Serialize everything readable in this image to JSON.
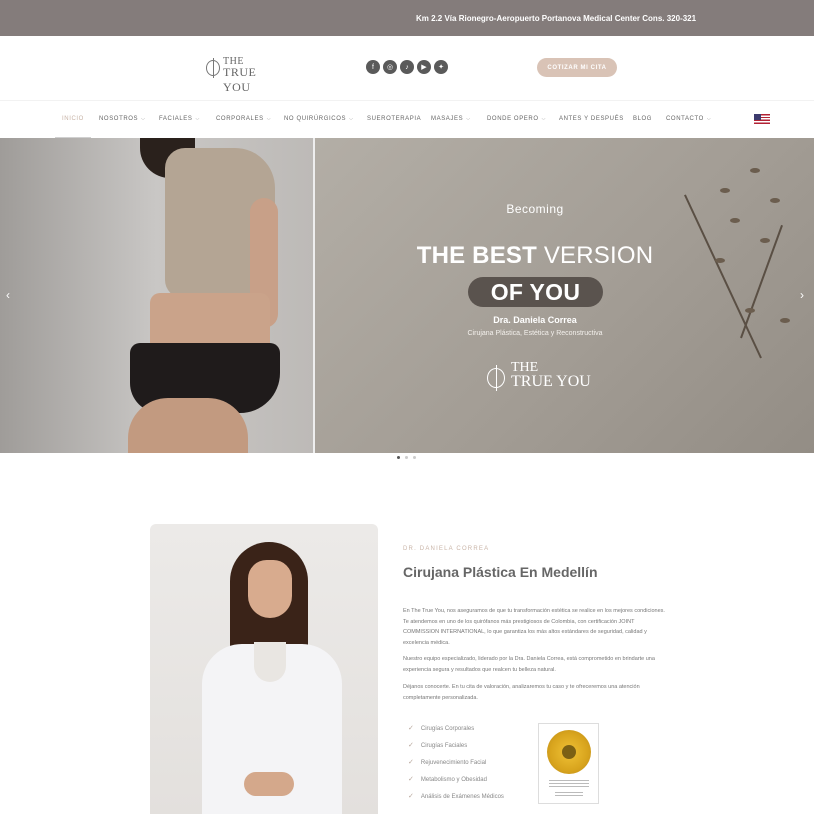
{
  "topbar": {
    "address": "Km 2.2 Vía Rionegro-Aeropuerto Portanova Medical Center Cons. 320-321"
  },
  "header": {
    "logo": {
      "line1": "THE",
      "line2": "TRUE YOU"
    },
    "socials": [
      {
        "icon": "facebook-icon",
        "glyph": "f"
      },
      {
        "icon": "instagram-icon",
        "glyph": "◎"
      },
      {
        "icon": "tiktok-icon",
        "glyph": "♪"
      },
      {
        "icon": "youtube-icon",
        "glyph": "▶"
      },
      {
        "icon": "twitter-icon",
        "glyph": "✦"
      }
    ],
    "cta_label": "COTIZAR MI CITA"
  },
  "nav": {
    "items": [
      {
        "label": "INICIO",
        "active": true,
        "dropdown": false
      },
      {
        "label": "NOSOTROS",
        "dropdown": true
      },
      {
        "label": "FACIALES",
        "dropdown": true
      },
      {
        "label": "CORPORALES",
        "dropdown": true
      },
      {
        "label": "NO QUIRÚRGICOS",
        "dropdown": true
      },
      {
        "label": "SUEROTERAPIA",
        "dropdown": false
      },
      {
        "label": "MASAJES",
        "dropdown": true
      },
      {
        "label": "DONDE OPERO",
        "dropdown": true
      },
      {
        "label": "ANTES Y DESPUÉS",
        "dropdown": false
      },
      {
        "label": "BLOG",
        "dropdown": false
      },
      {
        "label": "CONTACTO",
        "dropdown": true
      }
    ],
    "language_flag": "us-flag-icon"
  },
  "hero": {
    "becoming": "Becoming",
    "line1_bold": "THE BEST",
    "line1_rest": " VERSION",
    "pill": "OF YOU",
    "doctor": "Dra. Daniela Correa",
    "subtitle": "Cirujana Plástica, Estética y Reconstructiva",
    "logo": {
      "line1": "THE",
      "line2": "TRUE YOU"
    },
    "slides_total": 3,
    "slide_active": 1,
    "prev_glyph": "‹",
    "next_glyph": "›"
  },
  "about": {
    "kicker": "DR. DANIELA CORREA",
    "title": "Cirujana Plástica En Medellín",
    "p1": "En The True You, nos aseguramos de que tu transformación estética se realice en los mejores condiciones. Te atendemos en uno de los quirófanos más prestigiosos de Colombia, con certificación JOINT COMMISSION INTERNATIONAL, lo que garantiza los más altos estándares de seguridad, calidad y excelencia médica.",
    "p2": "Nuestro equipo especializado, liderado por la Dra. Daniela Correa, está comprometido en brindarte una experiencia segura y resultados que realcen tu belleza natural.",
    "p3": "Déjanos conocerte. En tu cita de valoración, analizaremos tu caso y te ofreceremos una atención completamente personalizada.",
    "services": [
      "Cirugías Corporales",
      "Cirugías Faciales",
      "Rejuvenecimiento Facial",
      "Metabolismo y Obesidad",
      "Análisis de Exámenes Médicos"
    ],
    "check_glyph": "✓"
  },
  "colors": {
    "topbar": "#847c7b",
    "accent": "#d9c3b6",
    "text": "#666666"
  }
}
